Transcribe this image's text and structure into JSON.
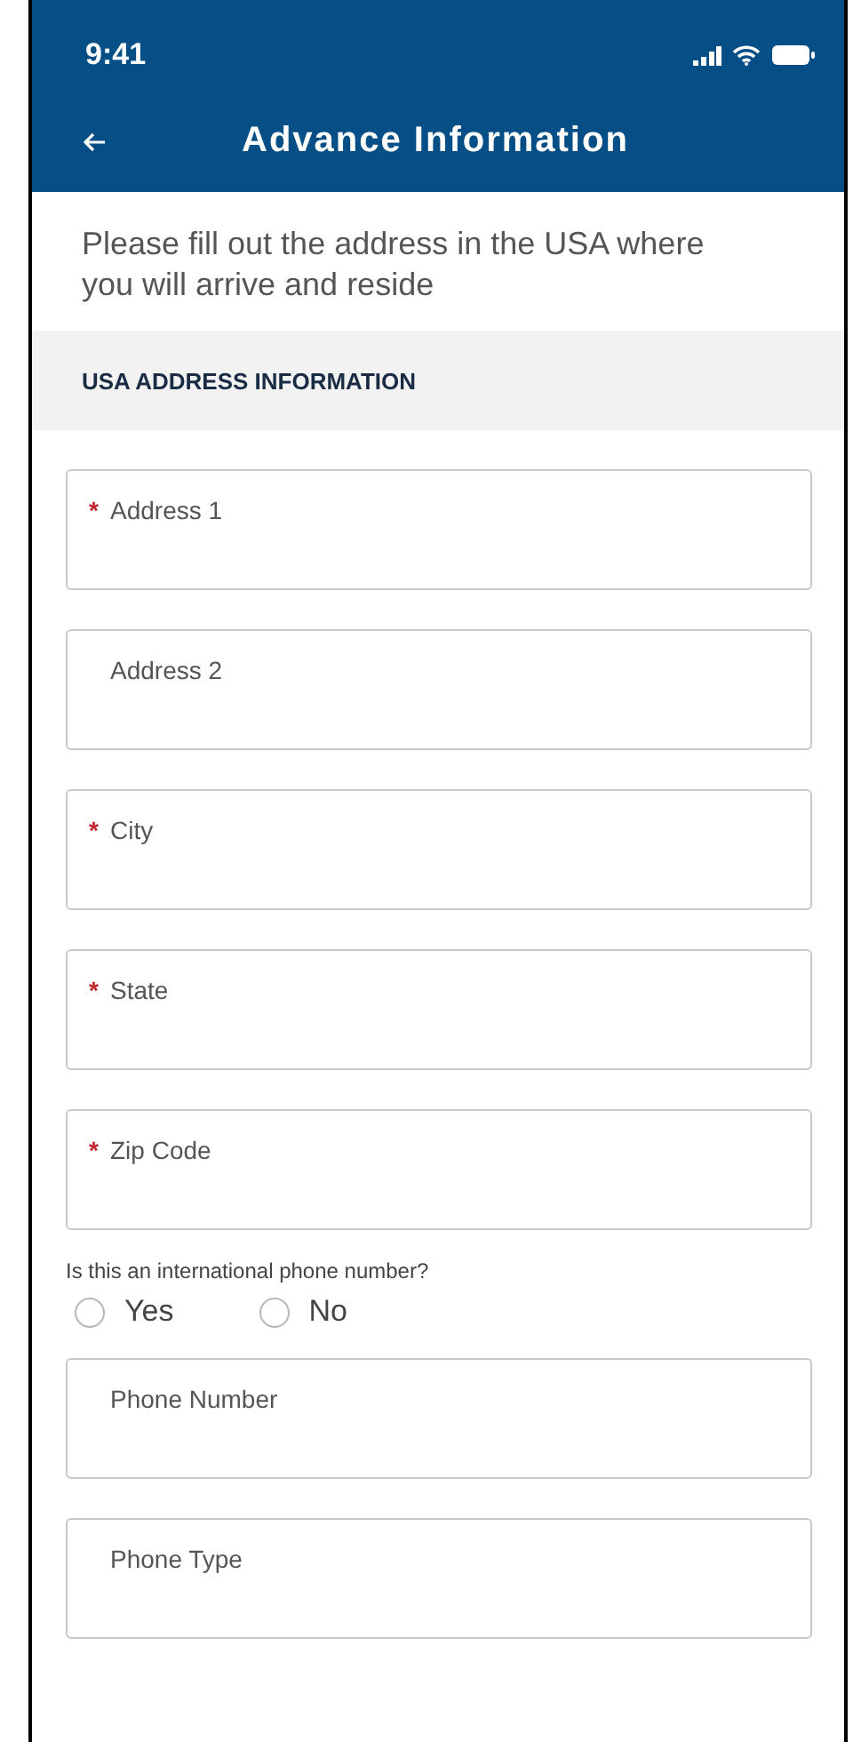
{
  "status_bar": {
    "time": "9:41"
  },
  "nav": {
    "title": "Advance Information"
  },
  "intro": "Please fill out the address in the USA where you will arrive and reside",
  "section": {
    "title": "USA ADDRESS INFORMATION"
  },
  "address_fields": [
    {
      "label": "Address 1",
      "required": true,
      "marker": "*"
    },
    {
      "label": "Address 2",
      "required": false
    },
    {
      "label": "City",
      "required": true,
      "marker": "*"
    },
    {
      "label": "State",
      "required": true,
      "marker": "*"
    },
    {
      "label": "Zip Code",
      "required": true,
      "marker": "*"
    }
  ],
  "phone_question": {
    "label": "Is this an international phone number?",
    "options": [
      {
        "label": "Yes",
        "selected": false
      },
      {
        "label": "No",
        "selected": false
      }
    ]
  },
  "phone_fields": [
    {
      "label": "Phone Number",
      "required": false
    },
    {
      "label": "Phone Type",
      "required": false
    }
  ]
}
